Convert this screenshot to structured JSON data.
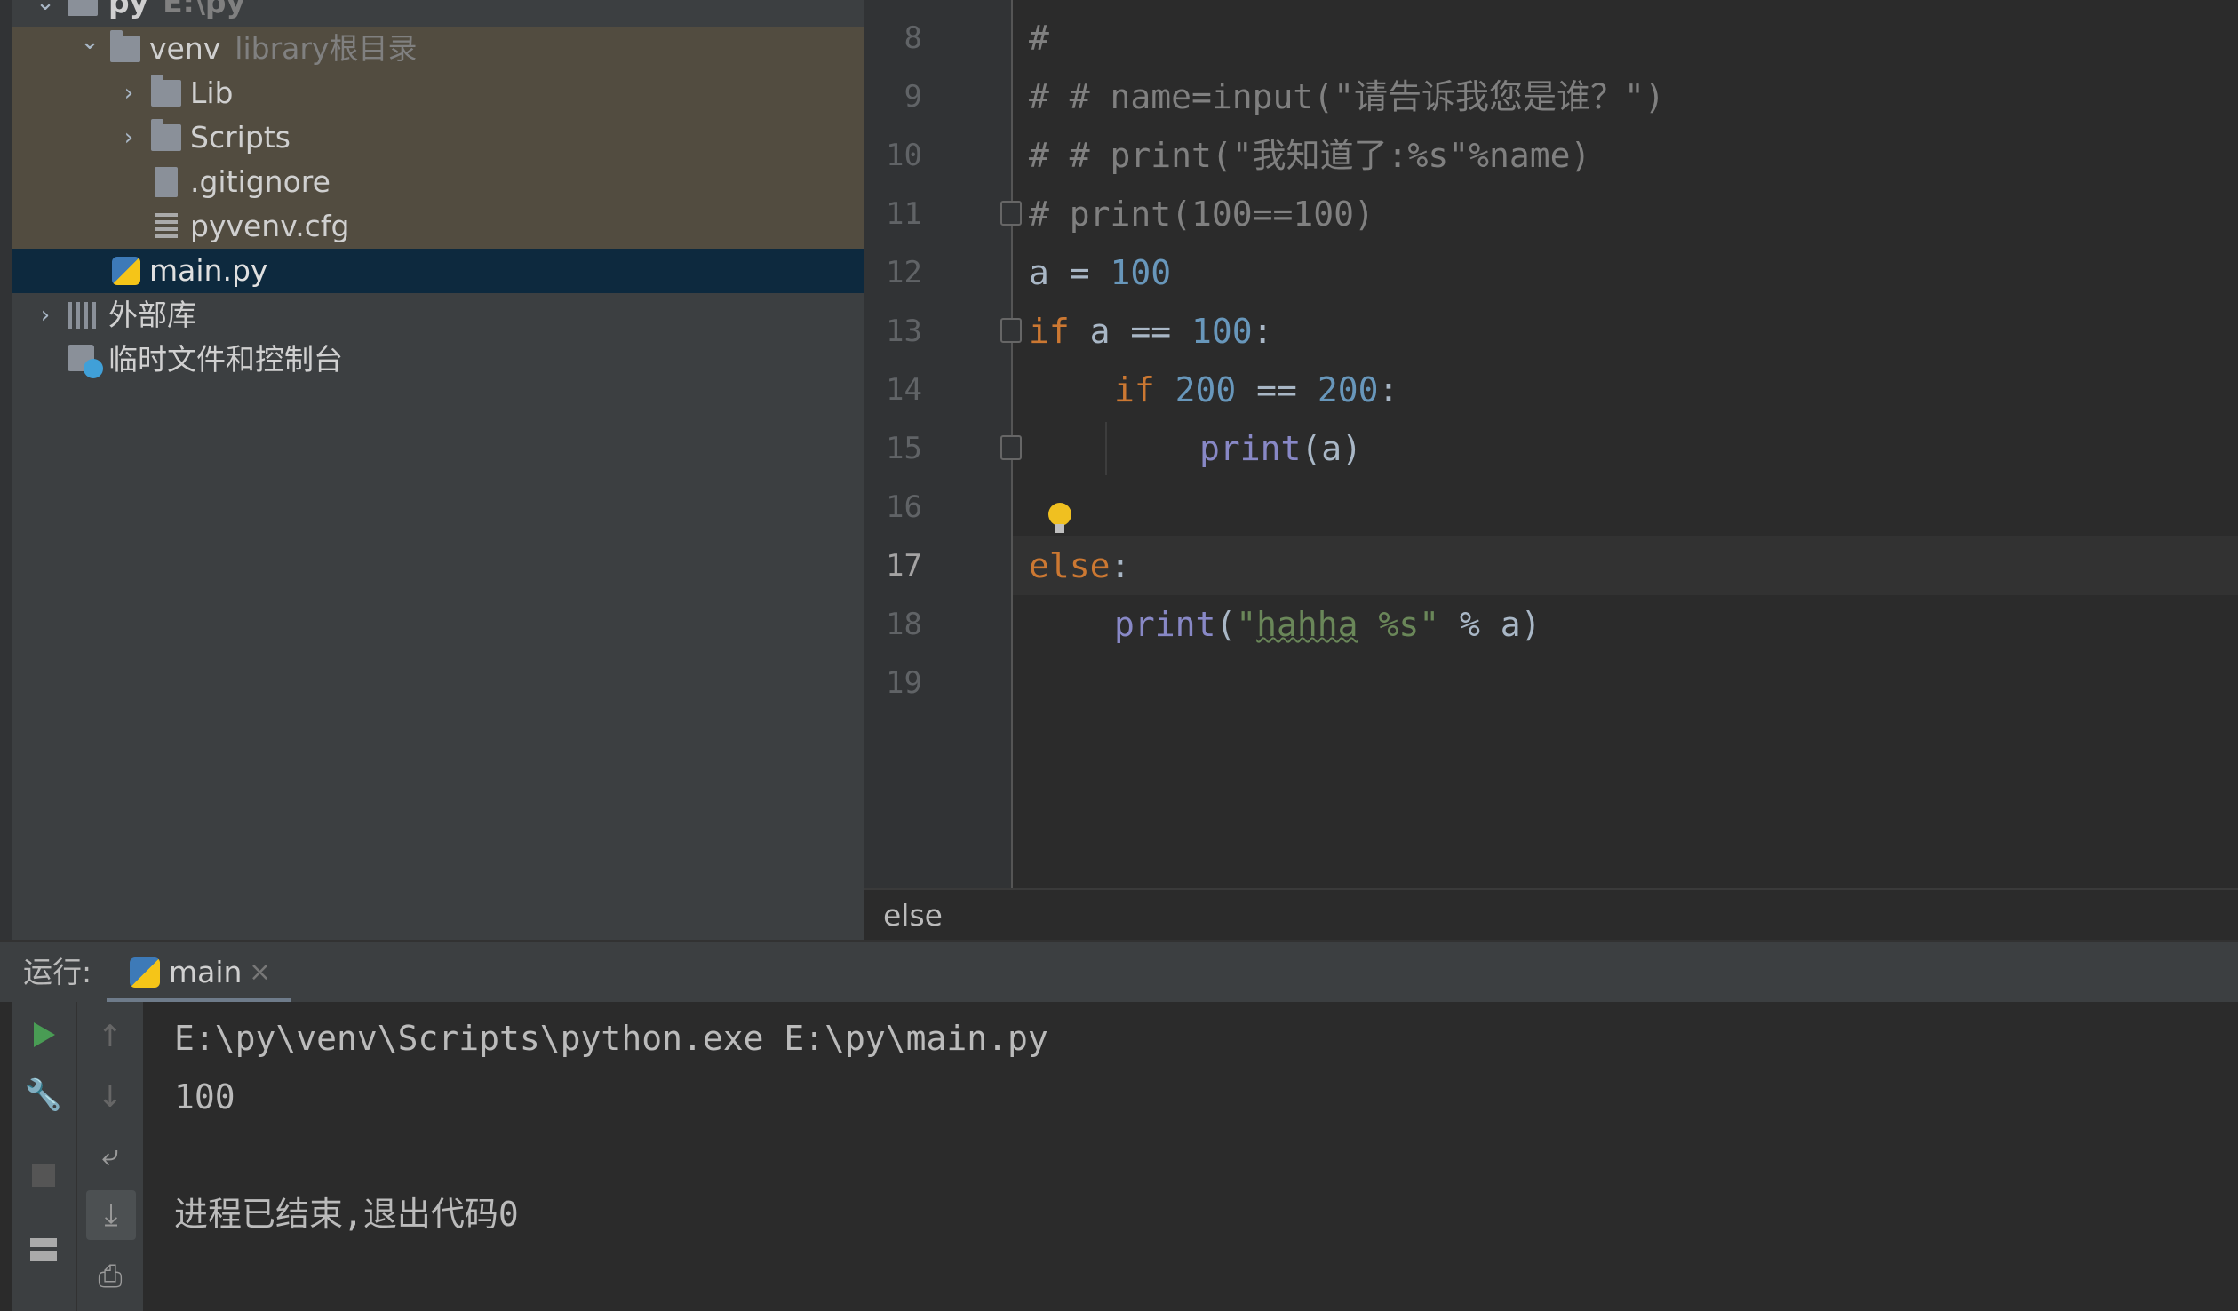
{
  "project": {
    "root": {
      "name": "py",
      "path": "E:\\py"
    },
    "items": [
      {
        "label": "venv",
        "hint": "library根目录"
      },
      {
        "label": "Lib"
      },
      {
        "label": "Scripts"
      },
      {
        "label": ".gitignore"
      },
      {
        "label": "pyvenv.cfg"
      },
      {
        "label": "main.py"
      },
      {
        "label": "外部库"
      },
      {
        "label": "临时文件和控制台"
      }
    ]
  },
  "editor": {
    "line_numbers": [
      "8",
      "9",
      "10",
      "11",
      "12",
      "13",
      "14",
      "15",
      "16",
      "17",
      "18",
      "19"
    ],
    "current_line": "17",
    "code": {
      "l8": "#",
      "l9": "# # name=input(\"请告诉我您是谁？\")",
      "l10": "# # print(\"我知道了:%s\"%name)",
      "l11": "# print(100==100)",
      "l12_a": "a",
      "l12_eq": " = ",
      "l12_num": "100",
      "l13_kw": "if",
      "l13_mid": " a == ",
      "l13_num": "100",
      "l13_end": ":",
      "l14_kw": "if",
      "l14_n1": "200",
      "l14_mid": " == ",
      "l14_n2": "200",
      "l14_end": ":",
      "l15_fn": "print",
      "l15_rest": "(a)",
      "l17_kw": "else",
      "l17_end": ":",
      "l18_fn": "print",
      "l18_open": "(",
      "l18_q1": "\"",
      "l18_word": "hahha",
      "l18_str": " %s\"",
      "l18_rest": " % a)"
    },
    "breadcrumb": "else"
  },
  "run": {
    "label": "运行:",
    "tab": "main",
    "close": "×",
    "output": [
      "E:\\py\\venv\\Scripts\\python.exe E:\\py\\main.py",
      "100",
      "",
      "进程已结束,退出代码0"
    ]
  },
  "colors": {
    "keyword": "#cc7832",
    "number": "#6897bb",
    "string": "#6a8759",
    "builtin": "#8888c6",
    "comment": "#808080",
    "run_icon": "#499c54",
    "selection": "#0d293e",
    "excluded_highlight": "#524c40"
  },
  "icons": [
    "folder-icon",
    "python-file-icon",
    "gitignore-file-icon",
    "config-file-icon",
    "library-icon",
    "scratch-icon",
    "run-icon",
    "wrench-icon",
    "stop-icon",
    "layout-icon",
    "arrow-up-icon",
    "arrow-down-icon",
    "soft-wrap-icon",
    "scroll-to-end-icon",
    "print-icon",
    "lightbulb-icon"
  ]
}
